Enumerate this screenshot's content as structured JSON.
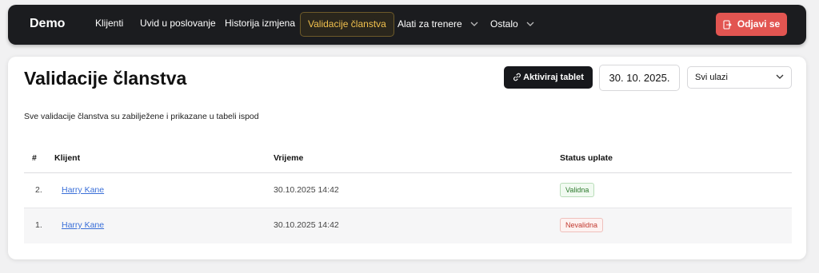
{
  "nav": {
    "brand": "Demo",
    "items": [
      {
        "label": "Klijenti"
      },
      {
        "label": "Uvid u poslovanje"
      },
      {
        "label": "Historija izmjena"
      },
      {
        "label": "Validacije članstva"
      },
      {
        "label": "Alati za trenere"
      },
      {
        "label": "Ostalo"
      }
    ],
    "logout_label": "Odjavi se"
  },
  "page": {
    "title": "Validacije članstva",
    "subtitle": "Sve validacije članstva su zabilježene i prikazane u tabeli ispod",
    "tablet_button": "Aktiviraj tablet",
    "date": "30. 10. 2025.",
    "entry_filter": "Svi ulazi"
  },
  "table": {
    "headers": {
      "num": "#",
      "client": "Klijent",
      "time": "Vrijeme",
      "status": "Status uplate"
    },
    "rows": [
      {
        "num": "2.",
        "client": "Harry Kane",
        "time": "30.10.2025 14:42",
        "status": "Validna"
      },
      {
        "num": "1.",
        "client": "Harry Kane",
        "time": "30.10.2025 14:42",
        "status": "Nevalidna"
      }
    ]
  },
  "colors": {
    "navbar": "#1b1c1f",
    "active_accent": "#f2c14e",
    "logout": "#e25551",
    "link": "#3a6fd8",
    "valid": "#2c7a2c",
    "invalid": "#c2392f"
  },
  "icons": [
    "chevron-down-icon",
    "logout-icon",
    "link-icon"
  ]
}
